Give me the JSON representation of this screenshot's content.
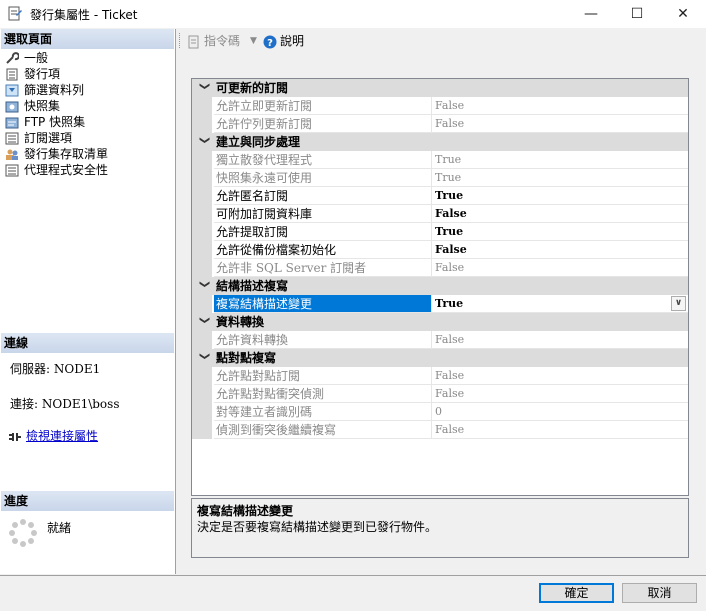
{
  "window": {
    "title": "發行集屬性 - Ticket",
    "minimize": "—",
    "maximize": "☐",
    "close": "✕"
  },
  "left_panel": {
    "select_page_header": "選取頁面",
    "pages": [
      {
        "label": "一般",
        "icon": "wrench-icon"
      },
      {
        "label": "發行項",
        "icon": "articles-icon"
      },
      {
        "label": "篩選資料列",
        "icon": "filter-icon"
      },
      {
        "label": "快照集",
        "icon": "snapshot-icon"
      },
      {
        "label": "FTP 快照集",
        "icon": "ftp-icon"
      },
      {
        "label": "訂閱選項",
        "icon": "subscription-icon"
      },
      {
        "label": "發行集存取清單",
        "icon": "users-icon"
      },
      {
        "label": "代理程式安全性",
        "icon": "security-icon"
      }
    ],
    "connection_header": "連線",
    "server_label": "伺服器: NODE1",
    "connection_label": "連接: NODE1\\boss",
    "view_connection_link": "檢視連接屬性",
    "progress_header": "進度",
    "progress_status": "就緒"
  },
  "toolbar": {
    "script_label": "指令碼",
    "help_label": "說明"
  },
  "property_grid": {
    "categories": [
      {
        "name": "可更新的訂閱",
        "rows": [
          {
            "name": "允許立即更新訂閱",
            "value": "False",
            "readonly": true
          },
          {
            "name": "允許佇列更新訂閱",
            "value": "False",
            "readonly": true
          }
        ]
      },
      {
        "name": "建立與同步處理",
        "rows": [
          {
            "name": "獨立散發代理程式",
            "value": "True",
            "readonly": true
          },
          {
            "name": "快照集永遠可使用",
            "value": "True",
            "readonly": true
          },
          {
            "name": "允許匿名訂閱",
            "value": "True",
            "readonly": false
          },
          {
            "name": "可附加訂閱資料庫",
            "value": "False",
            "readonly": false
          },
          {
            "name": "允許提取訂閱",
            "value": "True",
            "readonly": false
          },
          {
            "name": "允許從備份檔案初始化",
            "value": "False",
            "readonly": false
          },
          {
            "name": "允許非 SQL Server 訂閱者",
            "value": "False",
            "readonly": true
          }
        ]
      },
      {
        "name": "結構描述複寫",
        "rows": [
          {
            "name": "複寫結構描述變更",
            "value": "True",
            "readonly": false,
            "selected": true
          }
        ]
      },
      {
        "name": "資料轉換",
        "rows": [
          {
            "name": "允許資料轉換",
            "value": "False",
            "readonly": true
          }
        ]
      },
      {
        "name": "點對點複寫",
        "rows": [
          {
            "name": "允許點對點訂閱",
            "value": "False",
            "readonly": true
          },
          {
            "name": "允許點對點衝突偵測",
            "value": "False",
            "readonly": true
          },
          {
            "name": "對等建立者識別碼",
            "value": "0",
            "readonly": true
          },
          {
            "name": "偵測到衝突後繼續複寫",
            "value": "False",
            "readonly": true
          }
        ]
      }
    ]
  },
  "description": {
    "title": "複寫結構描述變更",
    "text": "決定是否要複寫結構描述變更到已發行物件。"
  },
  "buttons": {
    "ok": "確定",
    "cancel": "取消"
  },
  "colors": {
    "selection": "#0078d7",
    "category_bg": "#dcdcdc",
    "section_header": "#c9d6ea",
    "link": "#0000cc"
  }
}
